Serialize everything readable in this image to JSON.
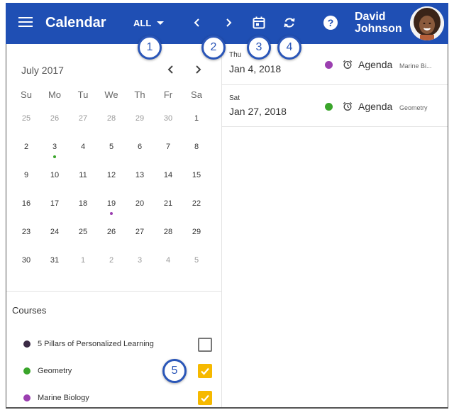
{
  "header": {
    "title": "Calendar",
    "filter_label": "ALL",
    "user_first": "David",
    "user_last": "Johnson",
    "accent_color": "#1f4fb4",
    "icons": [
      "menu-icon",
      "chevron-left-icon",
      "chevron-right-icon",
      "calendar-today-icon",
      "sync-icon",
      "help-icon"
    ]
  },
  "callouts": [
    "1",
    "2",
    "3",
    "4",
    "5"
  ],
  "calendar": {
    "month_label": "July 2017",
    "weekdays": [
      "Su",
      "Mo",
      "Tu",
      "We",
      "Th",
      "Fr",
      "Sa"
    ],
    "weeks": [
      [
        "25",
        "26",
        "27",
        "28",
        "29",
        "30",
        "1"
      ],
      [
        "2",
        "3",
        "4",
        "5",
        "6",
        "7",
        "8"
      ],
      [
        "9",
        "10",
        "11",
        "12",
        "13",
        "14",
        "15"
      ],
      [
        "16",
        "17",
        "18",
        "19",
        "20",
        "21",
        "22"
      ],
      [
        "23",
        "24",
        "25",
        "26",
        "27",
        "28",
        "29"
      ],
      [
        "30",
        "31",
        "1",
        "2",
        "3",
        "4",
        "5"
      ]
    ],
    "event_days": [
      {
        "day": "3",
        "color": "#3aa52b"
      },
      {
        "day": "19",
        "color": "#9b3fb0"
      }
    ]
  },
  "courses": {
    "title": "Courses",
    "items": [
      {
        "name": "5 Pillars of Personalized Learning",
        "color": "#3b2a45",
        "checked": false
      },
      {
        "name": "Geometry",
        "color": "#3aa52b",
        "checked": true
      },
      {
        "name": "Marine Biology",
        "color": "#9b3fb0",
        "checked": true
      }
    ]
  },
  "agenda": {
    "items": [
      {
        "dow": "Thu",
        "date": "Jan 4, 2018",
        "color": "#9b3fb0",
        "type": "Agenda",
        "course": "Marine Bi..."
      },
      {
        "dow": "Sat",
        "date": "Jan 27, 2018",
        "color": "#3aa52b",
        "type": "Agenda",
        "course": "Geometry"
      }
    ]
  }
}
